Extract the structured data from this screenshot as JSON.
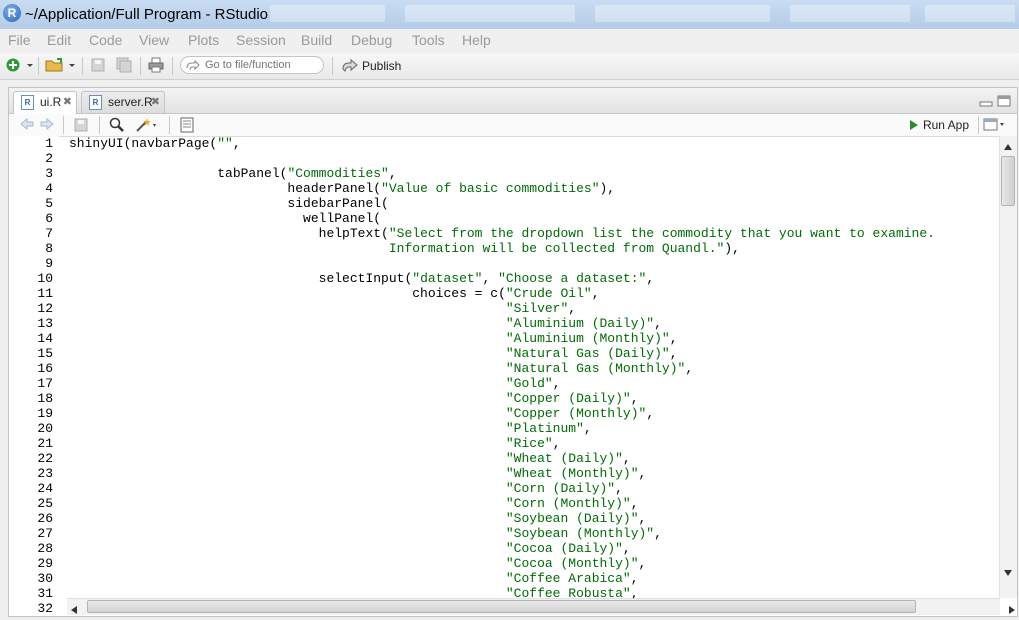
{
  "window": {
    "title": "~/Application/Full Program - RStudio"
  },
  "menu": [
    "File",
    "Edit",
    "Code",
    "View",
    "Plots",
    "Session",
    "Build",
    "Debug",
    "Tools",
    "Help"
  ],
  "toolbar": {
    "goto_placeholder": "Go to file/function",
    "publish_label": "Publish"
  },
  "tabs": [
    {
      "label": "ui.R",
      "active": true
    },
    {
      "label": "server.R",
      "active": false
    }
  ],
  "editor": {
    "run_app_label": "Run App",
    "line_numbers": [
      "1",
      "2",
      "3",
      "4",
      "5",
      "6",
      "7",
      "8",
      "9",
      "10",
      "11",
      "12",
      "13",
      "14",
      "15",
      "16",
      "17",
      "18",
      "19",
      "20",
      "21",
      "22",
      "23",
      "24",
      "25",
      "26",
      "27",
      "28",
      "29",
      "30",
      "31",
      "32"
    ],
    "lines": [
      "shinyUI(navbarPage(\"\",",
      "",
      "                   tabPanel(\"Commodities\",",
      "                            headerPanel(\"Value of basic commodities\"),",
      "                            sidebarPanel(",
      "                              wellPanel(",
      "                                helpText(\"Select from the dropdown list the commodity that you want to examine.",
      "                                         Information will be collected from Quandl.\"),",
      "",
      "                                selectInput(\"dataset\", \"Choose a dataset:\",",
      "                                            choices = c(\"Crude Oil\",",
      "                                                        \"Silver\",",
      "                                                        \"Aluminium (Daily)\",",
      "                                                        \"Aluminium (Monthly)\",",
      "                                                        \"Natural Gas (Daily)\",",
      "                                                        \"Natural Gas (Monthly)\",",
      "                                                        \"Gold\",",
      "                                                        \"Copper (Daily)\",",
      "                                                        \"Copper (Monthly)\",",
      "                                                        \"Platinum\",",
      "                                                        \"Rice\",",
      "                                                        \"Wheat (Daily)\",",
      "                                                        \"Wheat (Monthly)\",",
      "                                                        \"Corn (Daily)\",",
      "                                                        \"Corn (Monthly)\",",
      "                                                        \"Soybean (Daily)\",",
      "                                                        \"Soybean (Monthly)\",",
      "                                                        \"Cocoa (Daily)\",",
      "                                                        \"Cocoa (Monthly)\",",
      "                                                        \"Coffee Arabica\",",
      "                                                        \"Coffee Robusta\","
    ]
  },
  "colors": {
    "string": "#036a07",
    "keyword": "#000000"
  }
}
